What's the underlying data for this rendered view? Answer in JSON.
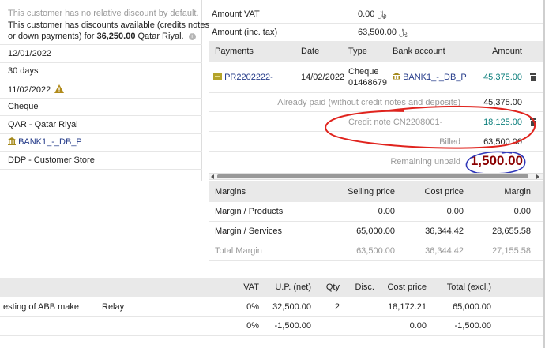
{
  "left_panel": {
    "no_discount_text": "This customer has no relative discount by default.",
    "discounts_line1": "This customer has discounts available (credits notes",
    "discounts_line2_prefix": "or down payments) for ",
    "discounts_amount": "36,250.00",
    "discounts_line2_suffix": " Qatar Riyal.",
    "fields": [
      {
        "value": "12/01/2022"
      },
      {
        "value": "30 days"
      },
      {
        "value": "11/02/2022"
      },
      {
        "value": "Cheque"
      },
      {
        "value": "QAR - Qatar Riyal"
      },
      {
        "value": "BANK1_-_DB_P"
      },
      {
        "value": "DDP - Customer Store"
      }
    ]
  },
  "amounts": {
    "vat_label": "Amount VAT",
    "vat_value": "0.00 ﷼",
    "inc_tax_label": "Amount (inc. tax)",
    "inc_tax_value": "63,500.00 ﷼"
  },
  "payments": {
    "headers": {
      "payments": "Payments",
      "date": "Date",
      "type": "Type",
      "bank": "Bank account",
      "amount": "Amount"
    },
    "row": {
      "ref": "PR2202222-",
      "date": "14/02/2022",
      "type_line1": "Cheque",
      "type_line2": "01468679",
      "bank": "BANK1_-_DB_P",
      "amount": "45,375.00"
    },
    "already_paid_label": "Already paid (without credit notes and deposits)",
    "already_paid_value": "45,375.00",
    "credit_note_label": "Credit note CN2208001-",
    "credit_note_value": "18,125.00",
    "billed_label": "Billed",
    "billed_value": "63,500.00",
    "remaining_label": "Remaining unpaid",
    "remaining_value": "1,500.00"
  },
  "margins": {
    "headers": {
      "name": "Margins",
      "selling": "Selling price",
      "cost": "Cost price",
      "margin": "Margin"
    },
    "rows": [
      {
        "name": "Margin / Products",
        "selling": "0.00",
        "cost": "0.00",
        "margin": "0.00"
      },
      {
        "name": "Margin / Services",
        "selling": "65,000.00",
        "cost": "36,344.42",
        "margin": "28,655.58"
      },
      {
        "name": "Total Margin",
        "selling": "63,500.00",
        "cost": "36,344.42",
        "margin": "27,155.58"
      }
    ]
  },
  "lines": {
    "headers": {
      "vat": "VAT",
      "up": "U.P. (net)",
      "qty": "Qty",
      "disc": "Disc.",
      "cost": "Cost price",
      "total": "Total (excl.)"
    },
    "rows": [
      {
        "desc": "esting of ABB make",
        "desc2": "Relay",
        "vat": "0%",
        "up": "32,500.00",
        "qty": "2",
        "disc": "",
        "cost": "18,172.21",
        "total": "65,000.00"
      },
      {
        "desc": "",
        "desc2": "",
        "vat": "0%",
        "up": "-1,500.00",
        "qty": "",
        "disc": "",
        "cost": "0.00",
        "total": "-1,500.00"
      }
    ]
  },
  "colors": {
    "accent_red": "#e0231d",
    "accent_blue": "#2e36b8",
    "remaining_red": "#8b0000",
    "header_gray": "#e9e9e9"
  }
}
